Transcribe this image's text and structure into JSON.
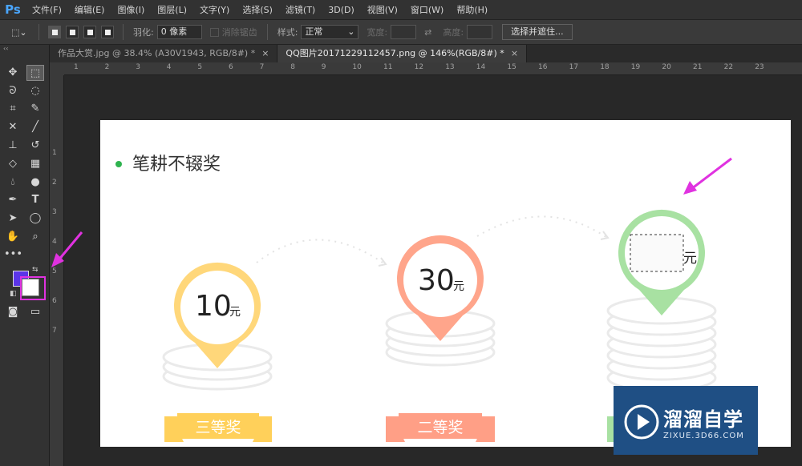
{
  "app": {
    "logo": "Ps"
  },
  "menu": [
    "文件(F)",
    "编辑(E)",
    "图像(I)",
    "图层(L)",
    "文字(Y)",
    "选择(S)",
    "滤镜(T)",
    "3D(D)",
    "视图(V)",
    "窗口(W)",
    "帮助(H)"
  ],
  "options": {
    "feather_label": "羽化:",
    "feather_value": "0 像素",
    "antialias_label": "消除锯齿",
    "style_label": "样式:",
    "style_value": "正常",
    "width_label": "宽度:",
    "height_label": "高度:",
    "select_mask_button": "选择并遮住..."
  },
  "tabs": [
    {
      "label": "作品大赏.jpg @ 38.4% (A30V1943, RGB/8#) *",
      "close": "×"
    },
    {
      "label": "QQ图片20171229112457.png @ 146%(RGB/8#) *",
      "close": "×"
    }
  ],
  "ruler": {
    "h_ticks": [
      "1",
      "2",
      "3",
      "4",
      "5",
      "6",
      "7",
      "8",
      "9",
      "10",
      "11",
      "12",
      "13",
      "14",
      "15",
      "16",
      "17",
      "18",
      "19",
      "20",
      "21",
      "22",
      "23"
    ],
    "v_ticks": [
      "1",
      "2",
      "3",
      "4",
      "5",
      "6",
      "7"
    ]
  },
  "document": {
    "heading": "笔耕不辍奖",
    "prizes": [
      {
        "amount": "10",
        "unit": "元",
        "rank": "三等奖"
      },
      {
        "amount": "30",
        "unit": "元",
        "rank": "二等奖"
      },
      {
        "amount": "",
        "unit": "元",
        "rank": ""
      }
    ]
  },
  "colors": {
    "foreground": "#5b35e8",
    "background": "#ffffff",
    "annotation_arrow": "#e032e0",
    "bullet": "#2fb34f",
    "prize3": "#ffd77a",
    "prize2": "#ffa58b",
    "prize1": "#a8e1a2",
    "ribbon3": "#ffd05a",
    "ribbon2": "#ff9f86"
  },
  "watermark": {
    "title": "溜溜自学",
    "url": "ZIXUE.3D66.COM"
  }
}
